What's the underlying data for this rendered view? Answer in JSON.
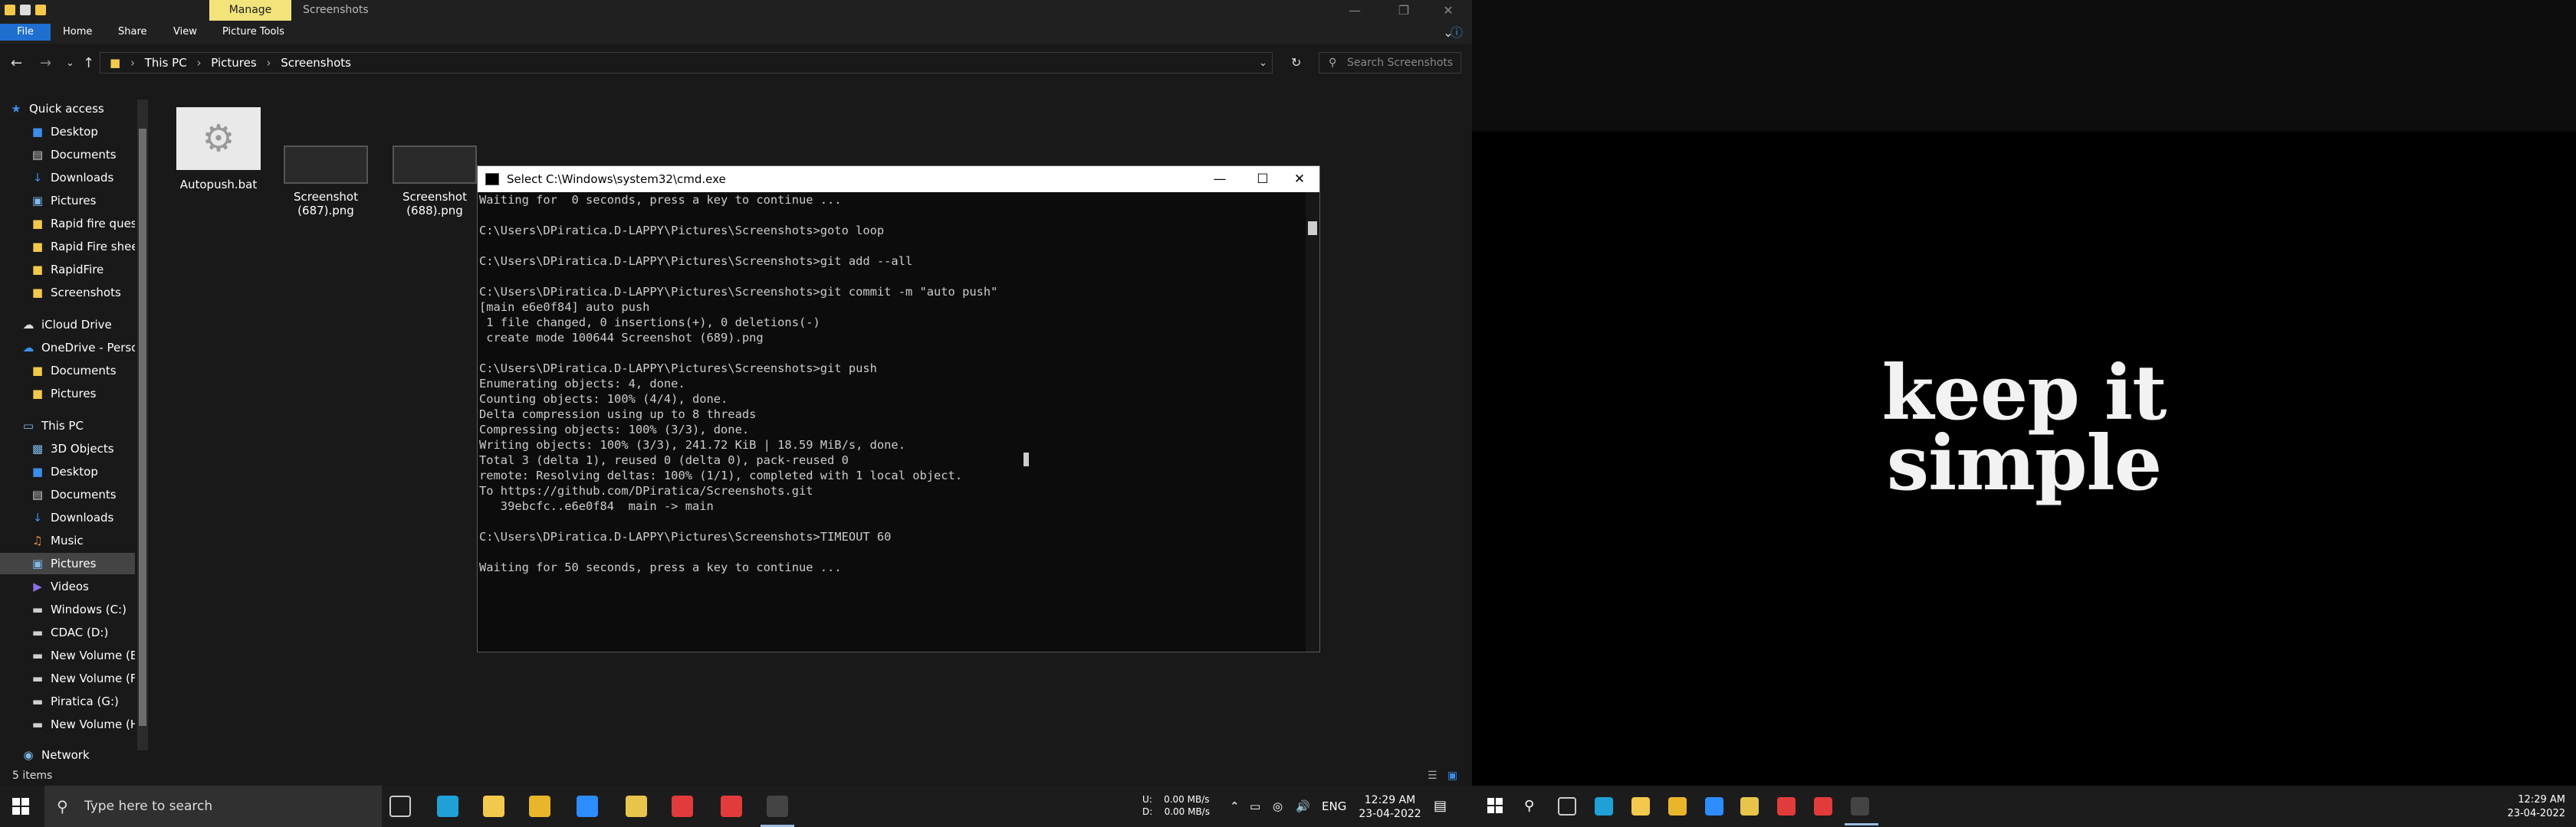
{
  "explorer": {
    "title": "Screenshots",
    "manage_tab": "Manage",
    "ribbon_tabs": [
      "File",
      "Home",
      "Share",
      "View",
      "Picture Tools"
    ],
    "breadcrumb": [
      "This PC",
      "Pictures",
      "Screenshots"
    ],
    "search_placeholder": "Search Screenshots",
    "nav": [
      {
        "label": "Quick access",
        "icon": "star-icon",
        "color": "#3c8ee8"
      },
      {
        "label": "Desktop",
        "icon": "folder-blue-icon",
        "pin": true
      },
      {
        "label": "Documents",
        "icon": "documents-icon",
        "pin": true
      },
      {
        "label": "Downloads",
        "icon": "download-icon",
        "pin": true
      },
      {
        "label": "Pictures",
        "icon": "pictures-icon",
        "pin": true
      },
      {
        "label": "Rapid fire questi",
        "icon": "folder-icon"
      },
      {
        "label": "Rapid Fire sheets",
        "icon": "folder-icon"
      },
      {
        "label": "RapidFire",
        "icon": "folder-icon"
      },
      {
        "label": "Screenshots",
        "icon": "folder-icon"
      },
      {
        "label": "iCloud Drive",
        "icon": "cloud-icon"
      },
      {
        "label": "OneDrive - Person",
        "icon": "onedrive-icon"
      },
      {
        "label": "Documents",
        "icon": "folder-icon"
      },
      {
        "label": "Pictures",
        "icon": "folder-icon"
      },
      {
        "label": "This PC",
        "icon": "computer-icon"
      },
      {
        "label": "3D Objects",
        "icon": "cube-icon"
      },
      {
        "label": "Desktop",
        "icon": "folder-blue-icon"
      },
      {
        "label": "Documents",
        "icon": "documents-icon"
      },
      {
        "label": "Downloads",
        "icon": "download-icon"
      },
      {
        "label": "Music",
        "icon": "music-icon"
      },
      {
        "label": "Pictures",
        "icon": "pictures-icon",
        "selected": true
      },
      {
        "label": "Videos",
        "icon": "videos-icon"
      },
      {
        "label": "Windows (C:)",
        "icon": "drive-icon"
      },
      {
        "label": "CDAC (D:)",
        "icon": "drive-icon"
      },
      {
        "label": "New Volume (E:)",
        "icon": "drive-icon"
      },
      {
        "label": "New Volume (F:)",
        "icon": "drive-icon"
      },
      {
        "label": "Piratica (G:)",
        "icon": "drive-icon"
      },
      {
        "label": "New Volume (H:)",
        "icon": "drive-icon"
      },
      {
        "label": "Network",
        "icon": "network-icon"
      }
    ],
    "files": [
      {
        "name": "Autopush.bat",
        "kind": "bat"
      },
      {
        "name": "Screenshot\n(687).png",
        "kind": "png"
      },
      {
        "name": "Screenshot\n(688).png",
        "kind": "png"
      }
    ],
    "status": "5 items"
  },
  "cmd": {
    "title": "Select C:\\Windows\\system32\\cmd.exe",
    "lines": [
      "Waiting for  0 seconds, press a key to continue ...",
      "",
      "C:\\Users\\DPiratica.D-LAPPY\\Pictures\\Screenshots>goto loop",
      "",
      "C:\\Users\\DPiratica.D-LAPPY\\Pictures\\Screenshots>git add --all",
      "",
      "C:\\Users\\DPiratica.D-LAPPY\\Pictures\\Screenshots>git commit -m \"auto push\"",
      "[main e6e0f84] auto push",
      " 1 file changed, 0 insertions(+), 0 deletions(-)",
      " create mode 100644 Screenshot (689).png",
      "",
      "C:\\Users\\DPiratica.D-LAPPY\\Pictures\\Screenshots>git push",
      "Enumerating objects: 4, done.",
      "Counting objects: 100% (4/4), done.",
      "Delta compression using up to 8 threads",
      "Compressing objects: 100% (3/3), done.",
      "Writing objects: 100% (3/3), 241.72 KiB | 18.59 MiB/s, done.",
      "Total 3 (delta 1), reused 0 (delta 0), pack-reused 0",
      "remote: Resolving deltas: 100% (1/1), completed with 1 local object.",
      "To https://github.com/DPiratica/Screenshots.git",
      "   39ebcfc..e6e0f84  main -> main",
      "",
      "C:\\Users\\DPiratica.D-LAPPY\\Pictures\\Screenshots>TIMEOUT 60",
      "",
      "Waiting for 50 seconds, press a key to continue ..."
    ]
  },
  "taskbar": {
    "search_placeholder": "Type here to search",
    "apps": [
      {
        "name": "task-view-icon",
        "color": "#cccccc"
      },
      {
        "name": "edge-icon",
        "color": "#1fa0d6"
      },
      {
        "name": "file-explorer-icon",
        "color": "#f2c94c"
      },
      {
        "name": "chrome-icon",
        "color": "#e9b62b"
      },
      {
        "name": "zoom-icon",
        "color": "#2d8cff"
      },
      {
        "name": "git-kraken-icon",
        "color": "#e8c54a"
      },
      {
        "name": "anydesk-icon",
        "color": "#e23b3b"
      },
      {
        "name": "anydesk-2-icon",
        "color": "#e23b3b"
      },
      {
        "name": "cmd-icon",
        "color": "#444444",
        "active": true
      }
    ],
    "net_up": "U:",
    "net_down": "D:",
    "net_up_val": "0.00 MB/s",
    "net_down_val": "0.00 MB/s",
    "lang": "ENG",
    "time": "12:29 AM",
    "date": "23-04-2022"
  },
  "desktop2": {
    "wallpaper_line1": "keep it",
    "wallpaper_line2": "simple",
    "time": "12:29 AM",
    "date": "23-04-2022"
  }
}
